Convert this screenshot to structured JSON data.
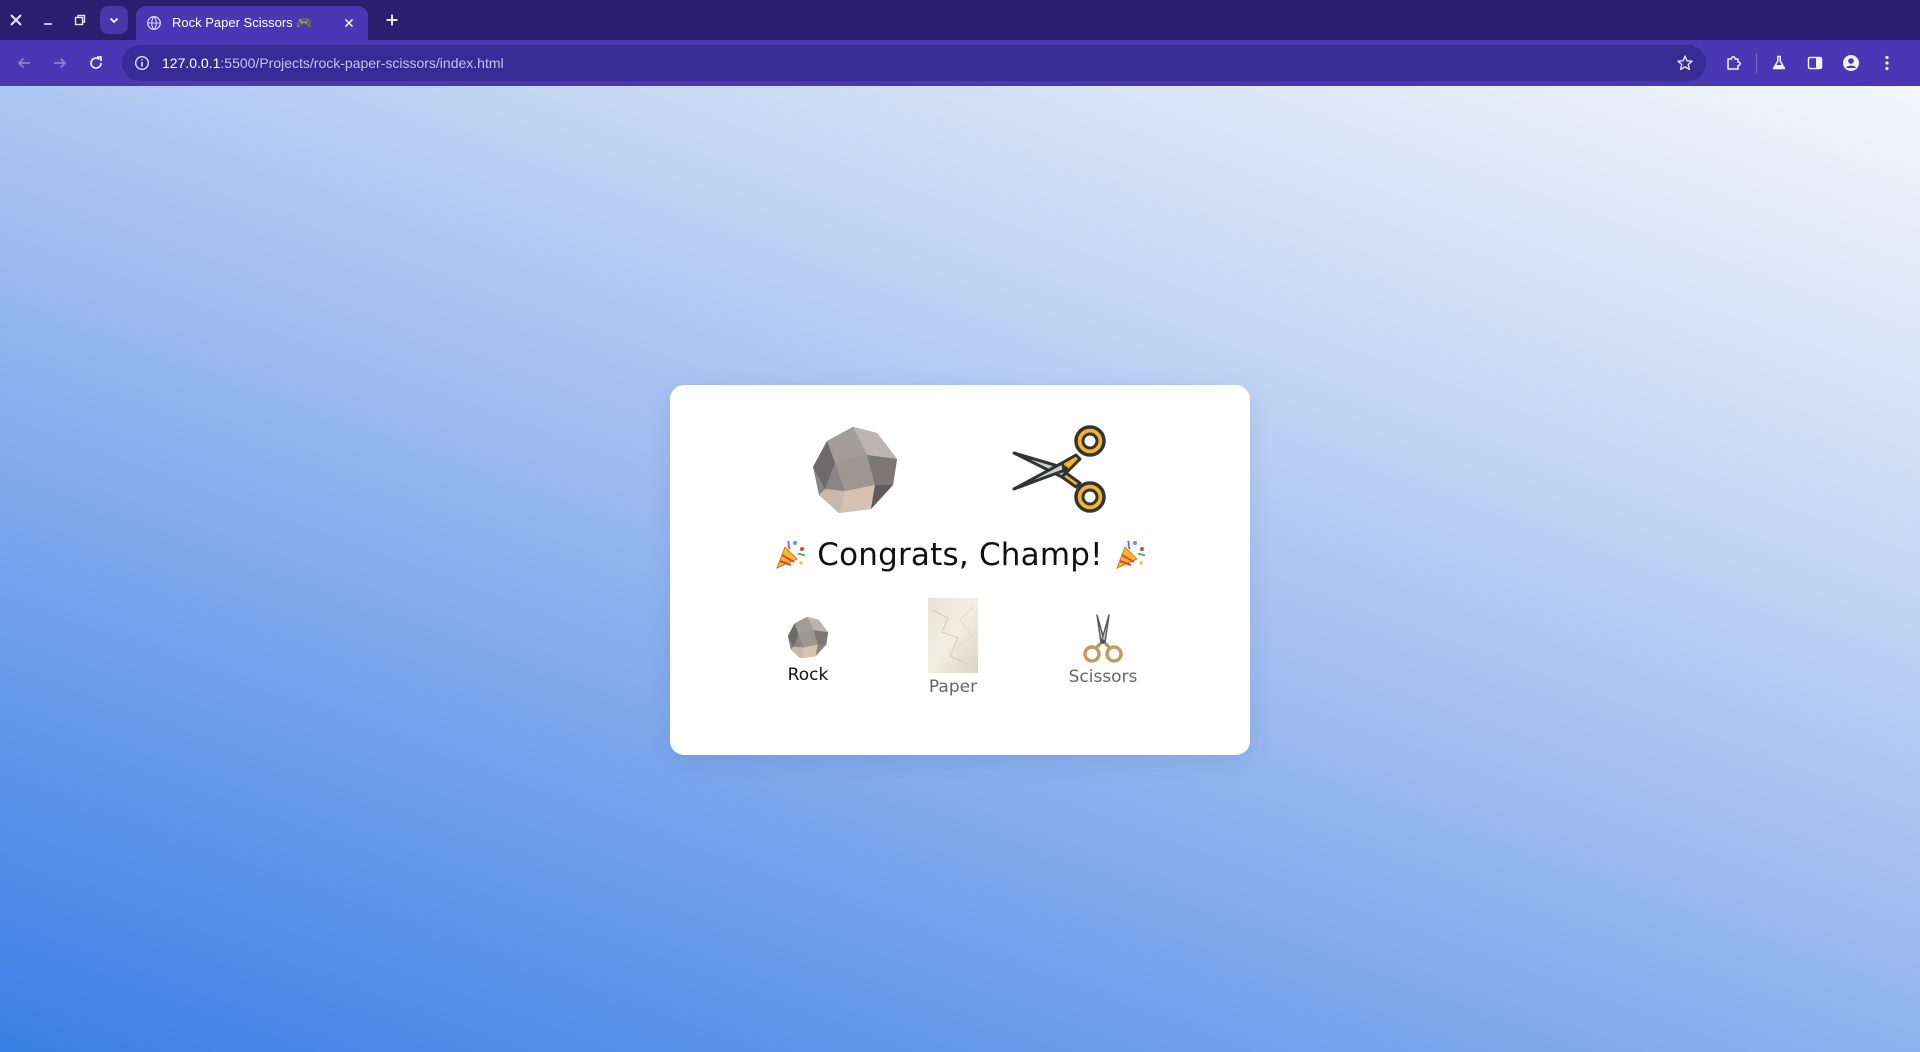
{
  "browser": {
    "tab_title": "Rock Paper Scissors 🎮",
    "url_host": "127.0.0.1",
    "url_path": ":5500/Projects/rock-paper-scissors/index.html"
  },
  "game": {
    "player_choice": "rock",
    "computer_choice": "scissors",
    "result_text": "Congrats, Champ!",
    "options": [
      {
        "id": "rock",
        "label": "Rock",
        "selected": true
      },
      {
        "id": "paper",
        "label": "Paper",
        "selected": false
      },
      {
        "id": "scissors",
        "label": "Scissors",
        "selected": false
      }
    ]
  },
  "icons": {
    "player": "rock-icon",
    "computer": "scissors-icon",
    "confetti": "party-popper-icon"
  },
  "colors": {
    "chrome_dark": "#2c1f6f",
    "chrome_tab": "#4b36b3",
    "card_bg": "#ffffff",
    "scissors_handle": "#f5b52a"
  }
}
